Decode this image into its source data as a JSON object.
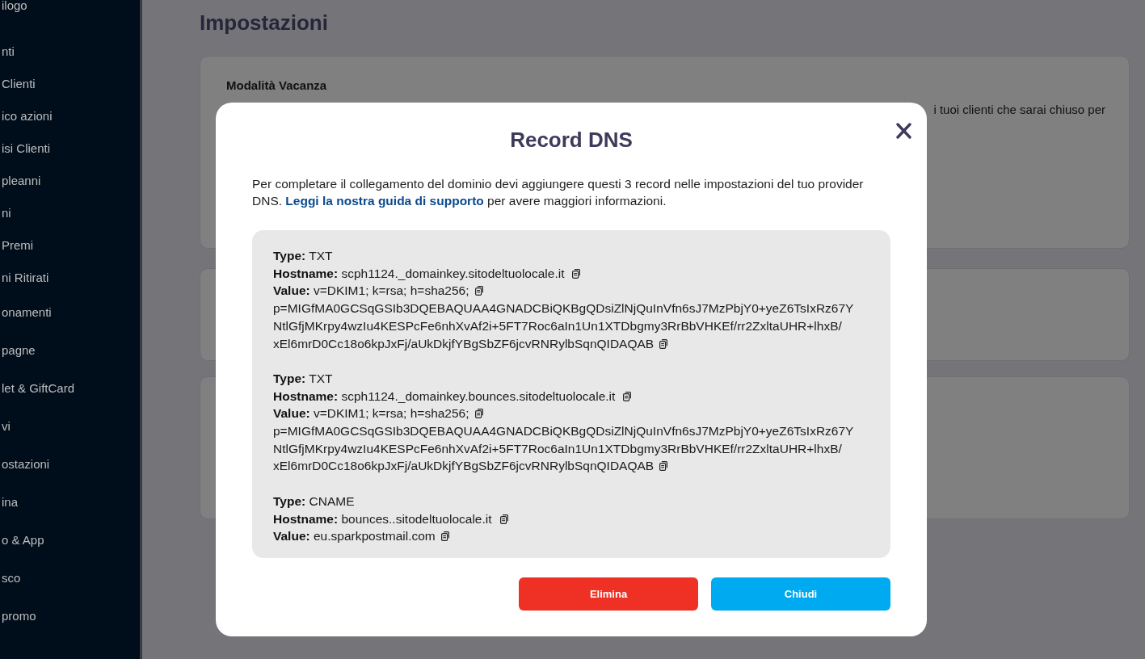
{
  "sidebar": {
    "items": [
      "ilogo",
      "nti",
      "Clienti",
      "ico azioni",
      "isi Clienti",
      "pleanni",
      "ni",
      "Premi",
      "ni Ritirati",
      "onamenti",
      "pagne",
      "let & GiftCard",
      "vi",
      "ostazioni",
      "ina",
      "o & App",
      "sco",
      "promo"
    ]
  },
  "page": {
    "title": "Impostazioni",
    "vacation_card": {
      "title": "Modalità Vacanza",
      "description": "i tuoi clienti che sarai chiuso per"
    }
  },
  "dialog": {
    "title": "Record DNS",
    "intro": {
      "text_before": "Per completare il collegamento del dominio devi aggiungere questi 3 record nelle impostazioni del tuo provider DNS.",
      "link": "Leggi la nostra guida di supporto",
      "text_after": "per avere maggiori informazioni."
    },
    "records": [
      {
        "fields": [
          {
            "label": "Type:",
            "parts": [
              {
                "text": "TXT",
                "copy": false
              }
            ]
          },
          {
            "label": "Hostname:",
            "parts": [
              {
                "text": "scph1124._domainkey.sitodeltuolocale.it",
                "copy": true
              }
            ]
          },
          {
            "label": "Value:",
            "parts": [
              {
                "text": "v=DKIM1; k=rsa; h=sha256;",
                "copy": true
              },
              {
                "text": "p=MIGfMA0GCSqGSIb3DQEBAQUAA4GNADCBiQKBgQDsiZlNjQuInVfn6sJ7MzPbjY0+yeZ6TsIxRz67Y",
                "copy": false
              },
              {
                "text": "NtlGfjMKrpy4wzIu4KESPcFe6nhXvAf2i+5FT7Roc6aIn1Un1XTDbgmy3RrBbVHKEf/rr2ZxltaUHR+lhxB/",
                "copy": false
              },
              {
                "text": "xEl6mrD0Cc18o6kpJxFj/aUkDkjfYBgSbZF6jcvRNRylbSqnQIDAQAB",
                "copy": true
              }
            ]
          }
        ]
      },
      {
        "fields": [
          {
            "label": "Type:",
            "parts": [
              {
                "text": "TXT",
                "copy": false
              }
            ]
          },
          {
            "label": "Hostname:",
            "parts": [
              {
                "text": "scph1124._domainkey.bounces.sitodeltuolocale.it",
                "copy": true
              }
            ]
          },
          {
            "label": "Value:",
            "parts": [
              {
                "text": "v=DKIM1; k=rsa; h=sha256;",
                "copy": true
              },
              {
                "text": "p=MIGfMA0GCSqGSIb3DQEBAQUAA4GNADCBiQKBgQDsiZlNjQuInVfn6sJ7MzPbjY0+yeZ6TsIxRz67Y",
                "copy": false
              },
              {
                "text": "NtlGfjMKrpy4wzIu4KESPcFe6nhXvAf2i+5FT7Roc6aIn1Un1XTDbgmy3RrBbVHKEf/rr2ZxltaUHR+lhxB/",
                "copy": false
              },
              {
                "text": "xEl6mrD0Cc18o6kpJxFj/aUkDkjfYBgSbZF6jcvRNRylbSqnQIDAQAB",
                "copy": true
              }
            ]
          }
        ]
      },
      {
        "fields": [
          {
            "label": "Type:",
            "parts": [
              {
                "text": "CNAME",
                "copy": false
              }
            ]
          },
          {
            "label": "Hostname:",
            "parts": [
              {
                "text": "bounces..sitodeltuolocale.it",
                "copy": true
              }
            ]
          },
          {
            "label": "Value:",
            "parts": [
              {
                "text": "eu.sparkpostmail.com",
                "copy": true
              }
            ]
          }
        ]
      }
    ],
    "buttons": [
      {
        "label": "Elimina",
        "kind": "danger"
      },
      {
        "label": "Chiudi",
        "kind": "primary"
      }
    ]
  }
}
